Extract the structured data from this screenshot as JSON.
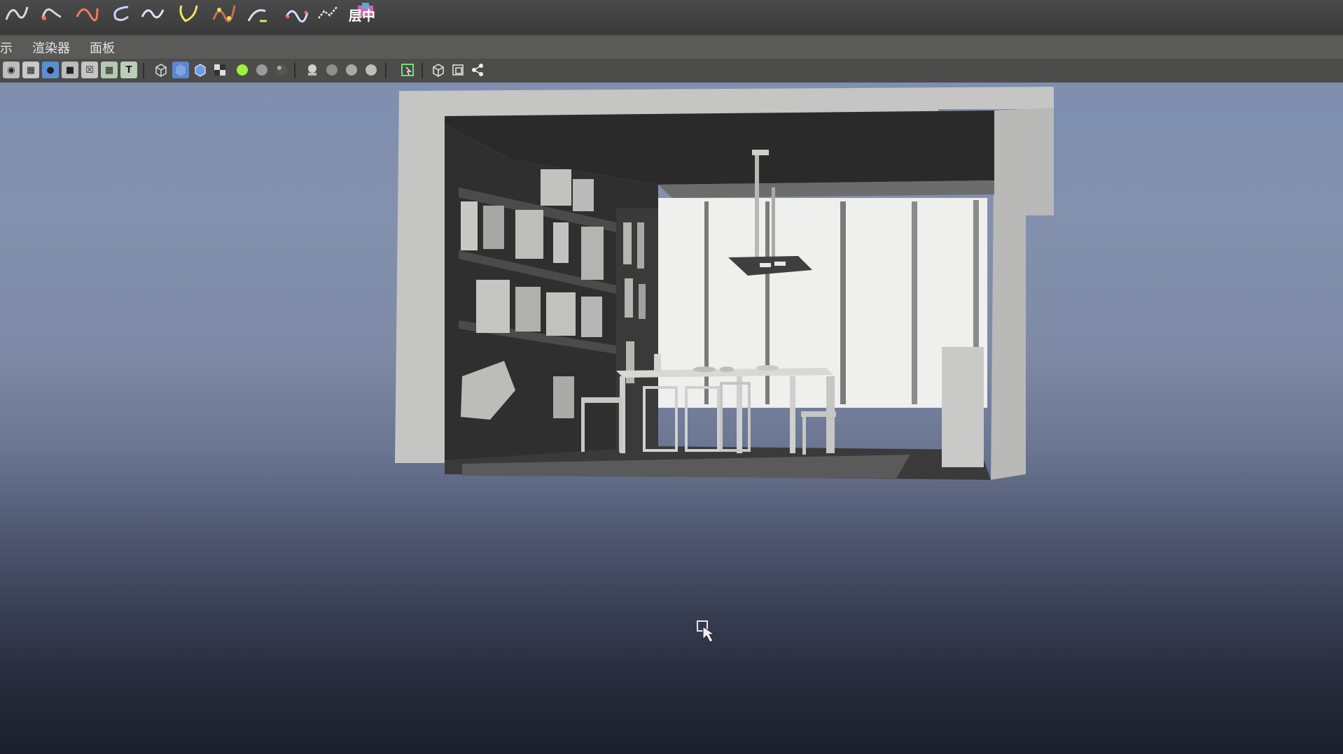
{
  "shelf": {
    "tool_label": "层中"
  },
  "panel_menu": {
    "items": [
      "示",
      "渲染器",
      "面板"
    ]
  },
  "viewport_toolbar": {
    "icons": [
      "camera-icon",
      "grid-icon",
      "image-plane-icon",
      "film-gate-icon",
      "resolution-gate-icon",
      "field-chart-icon",
      "safe-title-icon",
      "wireframe-cube-icon",
      "smooth-shade-cube-icon",
      "shaded-wireframe-icon",
      "checker-icon",
      "green-sphere-icon",
      "grey-sphere-icon",
      "dark-sphere-icon",
      "light-icon",
      "shadow-icon",
      "ambient-occlusion-icon",
      "motion-blur-icon",
      "isolate-select-icon",
      "xray-cube-icon",
      "xray-joints-icon",
      "hierarchy-icon"
    ]
  },
  "colors": {
    "shelf_bg": "#3f3f3f",
    "menu_bg": "#5a5a58",
    "toolbar_bg": "#4c4c4b",
    "viewport_top": "#7f8fb0",
    "viewport_bottom": "#1c1f2b",
    "model_light": "#c9c9c7",
    "model_dark": "#2d2d2d"
  },
  "viewport": {
    "content": "3d-room-model-dining-bookshelf"
  }
}
